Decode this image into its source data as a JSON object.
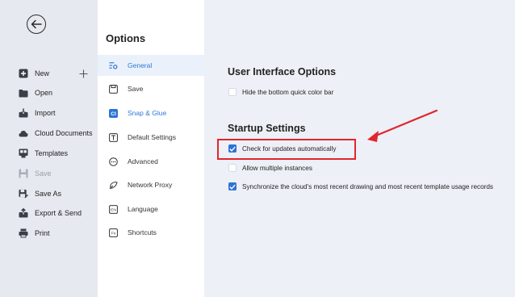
{
  "sidebar": {
    "items": [
      {
        "label": "New",
        "icon": "new-icon"
      },
      {
        "label": "Open",
        "icon": "folder-icon"
      },
      {
        "label": "Import",
        "icon": "import-icon"
      },
      {
        "label": "Cloud Documents",
        "icon": "cloud-icon"
      },
      {
        "label": "Templates",
        "icon": "templates-icon"
      },
      {
        "label": "Save",
        "icon": "save-icon",
        "disabled": true
      },
      {
        "label": "Save As",
        "icon": "save-as-icon"
      },
      {
        "label": "Export & Send",
        "icon": "export-icon"
      },
      {
        "label": "Print",
        "icon": "printer-icon"
      }
    ]
  },
  "options": {
    "title": "Options",
    "items": [
      {
        "label": "General",
        "icon": "general-icon",
        "active": true
      },
      {
        "label": "Save",
        "icon": "save-icon"
      },
      {
        "label": "Snap & Glue",
        "icon": "snap-icon"
      },
      {
        "label": "Default Settings",
        "icon": "default-settings-icon"
      },
      {
        "label": "Advanced",
        "icon": "advanced-icon"
      },
      {
        "label": "Network Proxy",
        "icon": "network-icon"
      },
      {
        "label": "Language",
        "icon": "language-icon",
        "badge": "EN"
      },
      {
        "label": "Shortcuts",
        "icon": "shortcuts-icon",
        "badge": "Fn"
      }
    ]
  },
  "content": {
    "ui_section": {
      "title": "User Interface Options",
      "options": [
        {
          "label": "Hide the bottom quick color bar",
          "checked": false
        }
      ]
    },
    "startup_section": {
      "title": "Startup Settings",
      "options": [
        {
          "label": "Check for updates automatically",
          "checked": true
        },
        {
          "label": "Allow multiple instances",
          "checked": false
        },
        {
          "label": "Synchronize the cloud's most recent drawing and most recent template usage records",
          "checked": true
        }
      ]
    }
  },
  "colors": {
    "accent": "#2d74d6",
    "annotation": "#e0262d",
    "sidebar_bg": "#e6e9ef",
    "content_bg": "#edf0f6"
  }
}
